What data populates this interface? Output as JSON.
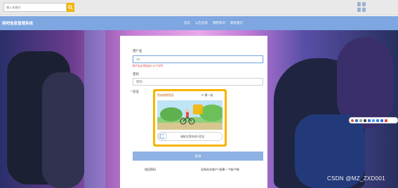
{
  "topbar": {
    "search_placeholder": "输入关键词"
  },
  "navbar": {
    "brand": "网吧信息管理系统",
    "items": [
      "首页",
      "公告信息",
      "网吧资讯",
      "联系我们"
    ]
  },
  "form": {
    "username_label": "用户名",
    "username_value": "18",
    "username_error": "账户名必须包含3-10个字符",
    "password_label": "密码",
    "password_placeholder": "密码",
    "captcha_label": "* 验证",
    "captcha_title": "完成拼图验证",
    "captcha_refresh": "换一张",
    "slider_text": "请按住滑块进行验证",
    "login_label": "登录",
    "forgot_label": "找回密码",
    "register_label": "没有存在账户?创建一个账户吧!"
  },
  "colors": {
    "nav": "#7ea6e0",
    "accent": "#f7b500",
    "login_button": "#8eb2e3",
    "error": "#d93a3a"
  },
  "watermark": "CSDN @MZ_ZXD001"
}
